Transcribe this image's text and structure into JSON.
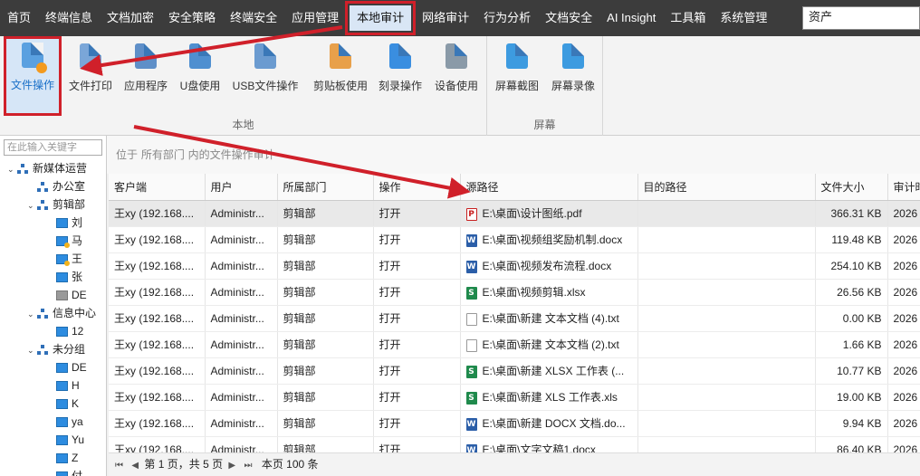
{
  "menu": {
    "items": [
      {
        "label": "首页"
      },
      {
        "label": "终端信息"
      },
      {
        "label": "文档加密"
      },
      {
        "label": "安全策略"
      },
      {
        "label": "终端安全"
      },
      {
        "label": "应用管理"
      },
      {
        "label": "本地审计"
      },
      {
        "label": "网络审计"
      },
      {
        "label": "行为分析"
      },
      {
        "label": "文档安全"
      },
      {
        "label": "AI Insight"
      },
      {
        "label": "工具箱"
      },
      {
        "label": "系统管理"
      }
    ],
    "active_index": 6,
    "search_value": "资产"
  },
  "ribbon": {
    "local_group_title": "本地",
    "screen_group_title": "屏幕",
    "buttons": [
      {
        "label": "文件操作",
        "icon": "file-operation-icon"
      },
      {
        "label": "文件打印",
        "icon": "printer-icon"
      },
      {
        "label": "应用程序",
        "icon": "application-icon"
      },
      {
        "label": "U盘使用",
        "icon": "usb-icon"
      },
      {
        "label": "USB文件操作",
        "icon": "usb-file-icon"
      },
      {
        "label": "剪贴板使用",
        "icon": "clipboard-icon"
      },
      {
        "label": "刻录操作",
        "icon": "disc-burn-icon"
      },
      {
        "label": "设备使用",
        "icon": "device-icon"
      },
      {
        "label": "屏幕截图",
        "icon": "camera-icon"
      },
      {
        "label": "屏幕录像",
        "icon": "video-icon"
      }
    ]
  },
  "tree": {
    "search_placeholder": "在此输入关键字",
    "nodes": [
      {
        "label": "新媒体运营",
        "type": "org",
        "level": 0,
        "expanded": true
      },
      {
        "label": "办公室",
        "type": "org",
        "level": 1
      },
      {
        "label": "剪辑部",
        "type": "org",
        "level": 1,
        "expanded": true
      },
      {
        "label": "刘",
        "type": "pc",
        "level": 2
      },
      {
        "label": "马",
        "type": "pc",
        "level": 2,
        "warn": true
      },
      {
        "label": "王",
        "type": "pc",
        "level": 2,
        "warn": true
      },
      {
        "label": "张",
        "type": "pc",
        "level": 2
      },
      {
        "label": "DE",
        "type": "pc-gray",
        "level": 2
      },
      {
        "label": "信息中心",
        "type": "org",
        "level": 1,
        "expanded": true
      },
      {
        "label": "12",
        "type": "pc",
        "level": 2
      },
      {
        "label": "未分组",
        "type": "org",
        "level": 1,
        "expanded": true
      },
      {
        "label": "DE",
        "type": "pc",
        "level": 2
      },
      {
        "label": "H",
        "type": "pc",
        "level": 2
      },
      {
        "label": "K",
        "type": "pc",
        "level": 2
      },
      {
        "label": "ya",
        "type": "pc",
        "level": 2
      },
      {
        "label": "Yu",
        "type": "pc",
        "level": 2
      },
      {
        "label": "Z",
        "type": "pc",
        "level": 2
      },
      {
        "label": "付",
        "type": "pc",
        "level": 2
      }
    ]
  },
  "breadcrumb": "位于 所有部门 内的文件操作审计",
  "table": {
    "columns": [
      "客户端",
      "用户",
      "所属部门",
      "操作",
      "源路径",
      "目的路径",
      "文件大小",
      "审计时间"
    ],
    "rows": [
      {
        "client": "王xy (192.168....",
        "user": "Administr...",
        "dept": "剪辑部",
        "op": "打开",
        "src": "E:\\桌面\\设计图纸.pdf",
        "ftype": "pdf",
        "dst": "",
        "size": "366.31 KB",
        "time": "2026"
      },
      {
        "client": "王xy (192.168....",
        "user": "Administr...",
        "dept": "剪辑部",
        "op": "打开",
        "src": "E:\\桌面\\视频组奖励机制.docx",
        "ftype": "word",
        "dst": "",
        "size": "119.48 KB",
        "time": "2026"
      },
      {
        "client": "王xy (192.168....",
        "user": "Administr...",
        "dept": "剪辑部",
        "op": "打开",
        "src": "E:\\桌面\\视频发布流程.docx",
        "ftype": "word",
        "dst": "",
        "size": "254.10 KB",
        "time": "2026"
      },
      {
        "client": "王xy (192.168....",
        "user": "Administr...",
        "dept": "剪辑部",
        "op": "打开",
        "src": "E:\\桌面\\视频剪辑.xlsx",
        "ftype": "excel",
        "dst": "",
        "size": "26.56 KB",
        "time": "2026"
      },
      {
        "client": "王xy (192.168....",
        "user": "Administr...",
        "dept": "剪辑部",
        "op": "打开",
        "src": "E:\\桌面\\新建 文本文档 (4).txt",
        "ftype": "txt",
        "dst": "",
        "size": "0.00 KB",
        "time": "2026"
      },
      {
        "client": "王xy (192.168....",
        "user": "Administr...",
        "dept": "剪辑部",
        "op": "打开",
        "src": "E:\\桌面\\新建 文本文档 (2).txt",
        "ftype": "txt",
        "dst": "",
        "size": "1.66 KB",
        "time": "2026"
      },
      {
        "client": "王xy (192.168....",
        "user": "Administr...",
        "dept": "剪辑部",
        "op": "打开",
        "src": "E:\\桌面\\新建 XLSX 工作表 (...",
        "ftype": "excel",
        "dst": "",
        "size": "10.77 KB",
        "time": "2026"
      },
      {
        "client": "王xy (192.168....",
        "user": "Administr...",
        "dept": "剪辑部",
        "op": "打开",
        "src": "E:\\桌面\\新建 XLS 工作表.xls",
        "ftype": "excel",
        "dst": "",
        "size": "19.00 KB",
        "time": "2026"
      },
      {
        "client": "王xy (192.168....",
        "user": "Administr...",
        "dept": "剪辑部",
        "op": "打开",
        "src": "E:\\桌面\\新建 DOCX 文档.do...",
        "ftype": "word",
        "dst": "",
        "size": "9.94 KB",
        "time": "2026"
      },
      {
        "client": "王xy (192.168....",
        "user": "Administr...",
        "dept": "剪辑部",
        "op": "打开",
        "src": "E:\\桌面\\文字文稿1.docx",
        "ftype": "word",
        "dst": "",
        "size": "86.40 KB",
        "time": "2026"
      }
    ]
  },
  "pager": {
    "page_text": "第 1 页，共 5 页",
    "count_text": "本页 100 条"
  },
  "colors": {
    "menubar_bg": "#3c3c3c",
    "highlight_red": "#d0202a",
    "accent_blue": "#1a70c8"
  }
}
